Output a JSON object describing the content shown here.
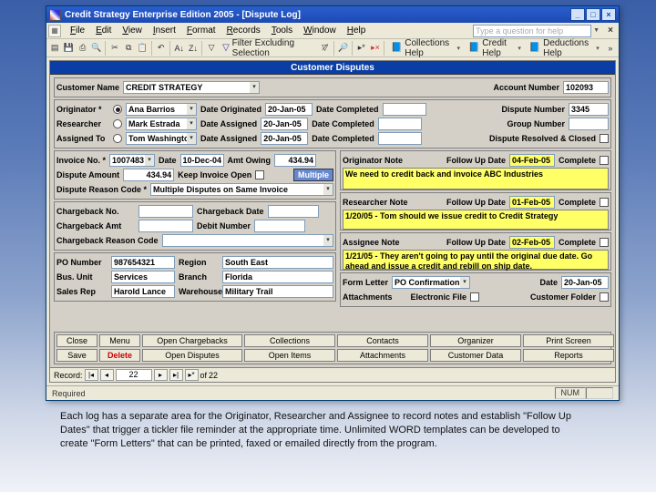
{
  "window": {
    "title": "Credit Strategy Enterprise Edition 2005 - [Dispute Log]"
  },
  "menubar": {
    "items": [
      "File",
      "Edit",
      "View",
      "Insert",
      "Format",
      "Records",
      "Tools",
      "Window",
      "Help"
    ],
    "help_placeholder": "Type a question for help"
  },
  "toolbar2": {
    "filter": "Filter Excluding Selection",
    "collections": "Collections Help",
    "credit": "Credit Help",
    "deductions": "Deductions Help"
  },
  "form": {
    "title": "Customer Disputes",
    "header": {
      "customer_name_lbl": "Customer Name",
      "customer_name": "CREDIT STRATEGY",
      "account_number_lbl": "Account Number",
      "account_number": "102093"
    },
    "assign": {
      "originator_lbl": "Originator *",
      "originator": "Ana Barrios",
      "researcher_lbl": "Researcher",
      "researcher": "Mark Estrada",
      "assigned_lbl": "Assigned To",
      "assigned": "Tom Washington",
      "date_orig_lbl": "Date Originated",
      "date_orig": "20-Jan-05",
      "date_assn_lbl": "Date Assigned",
      "date_assn": "20-Jan-05",
      "date_assn2": "20-Jan-05",
      "date_comp_lbl": "Date Completed",
      "disp_num_lbl": "Dispute Number",
      "disp_num": "3345",
      "group_num_lbl": "Group Number",
      "resolved_lbl": "Dispute Resolved & Closed"
    },
    "invoice": {
      "inv_no_lbl": "Invoice No. *",
      "inv_no": "1007483",
      "date_lbl": "Date",
      "date": "10-Dec-04",
      "amt_owing_lbl": "Amt Owing",
      "amt_owing": "434.94",
      "disp_amt_lbl": "Dispute Amount",
      "disp_amt": "434.94",
      "keep_open_lbl": "Keep Invoice Open",
      "multiple_btn": "Multiple",
      "reason_lbl": "Dispute Reason Code *",
      "reason": "Multiple Disputes on Same Invoice"
    },
    "chargeback": {
      "cb_no_lbl": "Chargeback No.",
      "cb_date_lbl": "Chargeback Date",
      "cb_amt_lbl": "Chargeback Amt",
      "debit_lbl": "Debit Number",
      "cb_reason_lbl": "Chargeback Reason Code"
    },
    "po": {
      "po_lbl": "PO Number",
      "po": "987654321",
      "region_lbl": "Region",
      "region": "South East",
      "bu_lbl": "Bus. Unit",
      "bu": "Services",
      "branch_lbl": "Branch",
      "branch": "Florida",
      "rep_lbl": "Sales Rep",
      "rep": "Harold Lance",
      "wh_lbl": "Warehouse",
      "wh": "Military Trail"
    },
    "notes": {
      "orig_note_lbl": "Originator Note",
      "fup_lbl": "Follow Up Date",
      "orig_fup": "04-Feb-05",
      "complete_lbl": "Complete",
      "orig_note": "We need to credit back and invoice ABC Industries",
      "res_note_lbl": "Researcher Note",
      "res_fup": "01-Feb-05",
      "res_note": "1/20/05 - Tom should we issue credit to Credit Strategy",
      "asg_note_lbl": "Assignee Note",
      "asg_fup": "02-Feb-05",
      "asg_note": "1/21/05 - They aren't going to pay until the original due date. Go ahead and issue a credit and rebill on ship date.",
      "form_letter_lbl": "Form Letter",
      "form_letter": "PO Confirmation",
      "fl_date_lbl": "Date",
      "fl_date": "20-Jan-05",
      "attach_lbl": "Attachments",
      "efile_lbl": "Electronic File",
      "cfolder_lbl": "Customer Folder"
    },
    "buttons": {
      "row1": [
        "Close",
        "Menu",
        "Open Chargebacks",
        "Collections",
        "Contacts",
        "Organizer",
        "Print Screen"
      ],
      "row2": [
        "Save",
        "Delete",
        "Open Disputes",
        "Open Items",
        "Attachments",
        "Customer Data",
        "Reports"
      ]
    },
    "nav": {
      "record_lbl": "Record:",
      "current": "22",
      "of": "of",
      "total": "22"
    }
  },
  "statusbar": {
    "left": "Required",
    "num": "NUM"
  },
  "caption": "Each log has a separate area for the Originator, Researcher and Assignee to record notes and establish \"Follow Up Dates\" that trigger a tickler file reminder at the appropriate time. Unlimited WORD templates can be developed to create \"Form Letters\" that can be printed, faxed or emailed directly from the program."
}
